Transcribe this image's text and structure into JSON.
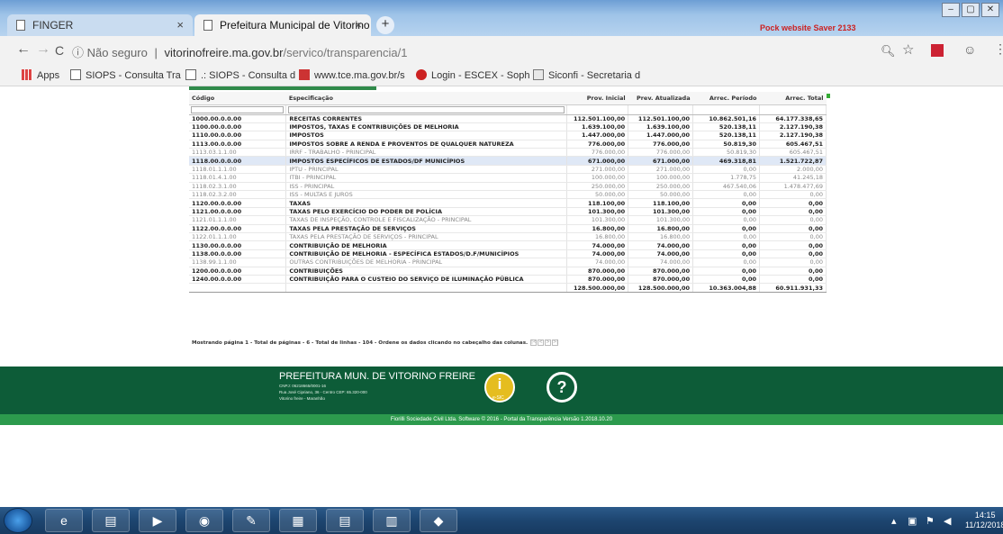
{
  "browser": {
    "tabs": [
      {
        "title": "FINGER",
        "close": "×"
      },
      {
        "title": "Prefeitura Municipal de Vitorino",
        "close": "×"
      }
    ],
    "new_tab": "+",
    "window_buttons": [
      "–",
      "▢",
      "✕"
    ],
    "corner_text": "Pock website Saver 2133",
    "nav": {
      "back": "←",
      "forward": "→",
      "reload": "C"
    },
    "url": {
      "security": "ⓘ Não seguro",
      "separator": "|",
      "host": "vitorinofreire.ma.gov.br",
      "path": "/servico/transparencia/1"
    },
    "bookmarks": [
      {
        "label": "Apps"
      },
      {
        "label": "SIOPS - Consulta Tra"
      },
      {
        "label": ".: SIOPS - Consulta d"
      },
      {
        "label": "www.tce.ma.gov.br/s"
      },
      {
        "label": "Login - ESCEX - Soph"
      },
      {
        "label": "Siconfi - Secretaria d"
      }
    ]
  },
  "table": {
    "headers": [
      "Código",
      "Especificação",
      "Prov. Inicial",
      "Prev. Atualizada",
      "Arrec. Período",
      "Arrec. Total"
    ],
    "rows": [
      {
        "codigo": "1000.00.0.0.00",
        "especificacao": "RECEITAS CORRENTES",
        "prov_inicial": "112.501.100,00",
        "prev_atualizada": "112.501.100,00",
        "arrec_periodo": "10.862.501,16",
        "arrec_total": "64.177.338,65",
        "style": "bold"
      },
      {
        "codigo": "1100.00.0.0.00",
        "especificacao": "IMPOSTOS, TAXAS E CONTRIBUIÇÕES DE MELHORIA",
        "prov_inicial": "1.639.100,00",
        "prev_atualizada": "1.639.100,00",
        "arrec_periodo": "520.138,11",
        "arrec_total": "2.127.190,38",
        "style": "bold"
      },
      {
        "codigo": "1110.00.0.0.00",
        "especificacao": "IMPOSTOS",
        "prov_inicial": "1.447.000,00",
        "prev_atualizada": "1.447.000,00",
        "arrec_periodo": "520.138,11",
        "arrec_total": "2.127.190,38",
        "style": "bold"
      },
      {
        "codigo": "1113.00.0.0.00",
        "especificacao": "IMPOSTOS SOBRE A RENDA E PROVENTOS DE QUALQUER NATUREZA",
        "prov_inicial": "776.000,00",
        "prev_atualizada": "776.000,00",
        "arrec_periodo": "50.819,30",
        "arrec_total": "605.467,51",
        "style": "bold"
      },
      {
        "codigo": "1113.03.1.1.00",
        "especificacao": "IRRF - TRABALHO - PRINCIPAL",
        "prov_inicial": "776.000,00",
        "prev_atualizada": "776.000,00",
        "arrec_periodo": "50.819,30",
        "arrec_total": "605.467,51",
        "style": "normal"
      },
      {
        "codigo": "1118.00.0.0.00",
        "especificacao": "IMPOSTOS ESPECÍFICOS DE ESTADOS/DF MUNICÍPIOS",
        "prov_inicial": "671.000,00",
        "prev_atualizada": "671.000,00",
        "arrec_periodo": "469.318,81",
        "arrec_total": "1.521.722,87",
        "style": "hl"
      },
      {
        "codigo": "1118.01.1.1.00",
        "especificacao": "IPTU - PRINCIPAL",
        "prov_inicial": "271.000,00",
        "prev_atualizada": "271.000,00",
        "arrec_periodo": "0,00",
        "arrec_total": "2.000,00",
        "style": "normal"
      },
      {
        "codigo": "1118.01.4.1.00",
        "especificacao": "ITBI - PRINCIPAL",
        "prov_inicial": "100.000,00",
        "prev_atualizada": "100.000,00",
        "arrec_periodo": "1.778,75",
        "arrec_total": "41.245,18",
        "style": "normal"
      },
      {
        "codigo": "1118.02.3.1.00",
        "especificacao": "ISS - PRINCIPAL",
        "prov_inicial": "250.000,00",
        "prev_atualizada": "250.000,00",
        "arrec_periodo": "467.540,06",
        "arrec_total": "1.478.477,69",
        "style": "normal"
      },
      {
        "codigo": "1118.02.3.2.00",
        "especificacao": "ISS - MULTAS E JUROS",
        "prov_inicial": "50.000,00",
        "prev_atualizada": "50.000,00",
        "arrec_periodo": "0,00",
        "arrec_total": "0,00",
        "style": "normal"
      },
      {
        "codigo": "1120.00.0.0.00",
        "especificacao": "TAXAS",
        "prov_inicial": "118.100,00",
        "prev_atualizada": "118.100,00",
        "arrec_periodo": "0,00",
        "arrec_total": "0,00",
        "style": "bold"
      },
      {
        "codigo": "1121.00.0.0.00",
        "especificacao": "TAXAS PELO EXERCÍCIO DO PODER DE POLÍCIA",
        "prov_inicial": "101.300,00",
        "prev_atualizada": "101.300,00",
        "arrec_periodo": "0,00",
        "arrec_total": "0,00",
        "style": "bold"
      },
      {
        "codigo": "1121.01.1.1.00",
        "especificacao": "TAXAS DE INSPEÇÃO, CONTROLE E FISCALIZAÇÃO - PRINCIPAL",
        "prov_inicial": "101.300,00",
        "prev_atualizada": "101.300,00",
        "arrec_periodo": "0,00",
        "arrec_total": "0,00",
        "style": "normal"
      },
      {
        "codigo": "1122.00.0.0.00",
        "especificacao": "TAXAS PELA PRESTAÇÃO DE SERVIÇOS",
        "prov_inicial": "16.800,00",
        "prev_atualizada": "16.800,00",
        "arrec_periodo": "0,00",
        "arrec_total": "0,00",
        "style": "bold"
      },
      {
        "codigo": "1122.01.1.1.00",
        "especificacao": "TAXAS PELA PRESTAÇÃO DE SERVIÇOS - PRINCIPAL",
        "prov_inicial": "16.800,00",
        "prev_atualizada": "16.800,00",
        "arrec_periodo": "0,00",
        "arrec_total": "0,00",
        "style": "normal"
      },
      {
        "codigo": "1130.00.0.0.00",
        "especificacao": "CONTRIBUIÇÃO DE MELHORIA",
        "prov_inicial": "74.000,00",
        "prev_atualizada": "74.000,00",
        "arrec_periodo": "0,00",
        "arrec_total": "0,00",
        "style": "bold"
      },
      {
        "codigo": "1138.00.0.0.00",
        "especificacao": "CONTRIBUIÇÃO DE MELHORIA - ESPECÍFICA ESTADOS/D.F/MUNICÍPIOS",
        "prov_inicial": "74.000,00",
        "prev_atualizada": "74.000,00",
        "arrec_periodo": "0,00",
        "arrec_total": "0,00",
        "style": "bold"
      },
      {
        "codigo": "1138.99.1.1.00",
        "especificacao": "OUTRAS CONTRIBUIÇÕES DE MELHORIA - PRINCIPAL",
        "prov_inicial": "74.000,00",
        "prev_atualizada": "74.000,00",
        "arrec_periodo": "0,00",
        "arrec_total": "0,00",
        "style": "normal"
      },
      {
        "codigo": "1200.00.0.0.00",
        "especificacao": "CONTRIBUIÇÕES",
        "prov_inicial": "870.000,00",
        "prev_atualizada": "870.000,00",
        "arrec_periodo": "0,00",
        "arrec_total": "0,00",
        "style": "bold"
      },
      {
        "codigo": "1240.00.0.0.00",
        "especificacao": "CONTRIBUIÇÃO PARA O CUSTEIO DO SERVIÇO DE ILUMINAÇÃO PÚBLICA",
        "prov_inicial": "870.000,00",
        "prev_atualizada": "870.000,00",
        "arrec_periodo": "0,00",
        "arrec_total": "0,00",
        "style": "bold"
      }
    ],
    "totals": {
      "prov_inicial": "128.500.000,00",
      "prev_atualizada": "128.500.000,00",
      "arrec_periodo": "10.363.004,88",
      "arrec_total": "60.911.931,33"
    }
  },
  "pager": {
    "text": "Mostrando página 1 - Total de páginas - 6 - Total de linhas - 104 - Ordene os dados clicando no cabeçalho das colunas.",
    "buttons": [
      "|<",
      "<",
      ">",
      ">|"
    ]
  },
  "footer": {
    "title": "PREFEITURA MUN. DE VITORINO FREIRE",
    "cnpj": "CNPJ: 06218665/0001-16",
    "address": "Rua José Cipriano, 36 - Centro CEP: 65.320-000",
    "city": "Vitorino freire - Maranhão",
    "esic_icon": "i",
    "esic_label": "e-SIC",
    "help_icon": "?",
    "copyright": "Fiorilli Sociedade Civil Ltda. Software © 2016 - Portal da Transparência Versão 1.2018.10.20"
  },
  "taskbar": {
    "clock_time": "14:15",
    "clock_date": "11/12/2018"
  },
  "colors": {
    "footer_green": "#0d5c38",
    "copyright_green": "#2c9a4d",
    "row_highlight": "#dfe8f6",
    "esic_yellow": "#e5bd1f"
  }
}
